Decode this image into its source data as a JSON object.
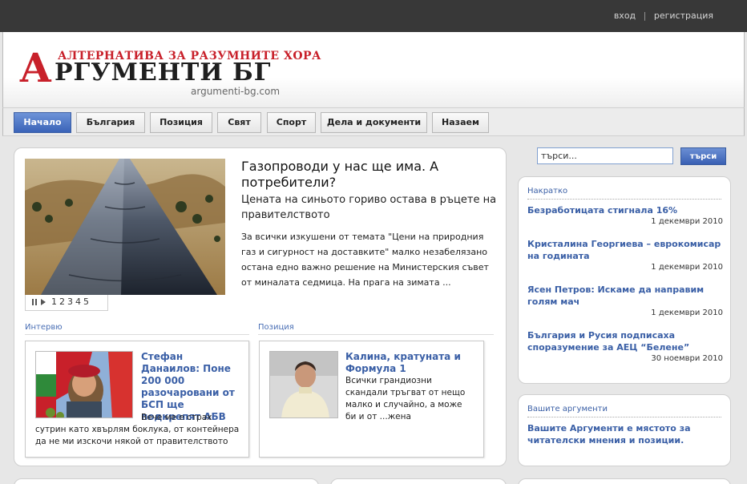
{
  "topbar": {
    "login": "вход",
    "separator": "|",
    "register": "регистрация"
  },
  "header": {
    "logo_initial": "А",
    "logo_rest": "РГУМЕНТИ БГ",
    "tagline": "АЛТЕРНАТИВА ЗА РАЗУМНИТЕ ХОРА",
    "domain": "argumenti-bg.com"
  },
  "nav": {
    "items": [
      {
        "label": "Начало",
        "active": true
      },
      {
        "label": "България"
      },
      {
        "label": "Позиция"
      },
      {
        "label": "Свят"
      },
      {
        "label": "Спорт"
      },
      {
        "label": "Дела и документи"
      },
      {
        "label": "Назаем"
      }
    ]
  },
  "search": {
    "placeholder": "търси...",
    "button": "търси"
  },
  "feature": {
    "title": "Газопроводи у нас ще има. А потребители?",
    "subtitle": "Цената на синьото гориво остава в ръцете на правителството",
    "text": "За всички изкушени от темата \"Цени на природния газ и сигурност на доставките\" малко незабелязано остана едно важно решение на Министерския съвет от миналата седмица. На прага на зимата ...",
    "slides": [
      "1",
      "2",
      "3",
      "4",
      "5"
    ]
  },
  "sections": {
    "left_label": "Интервю",
    "right_label": "Позиция"
  },
  "interview": {
    "title": "Стефан Данаилов: Поне 200 000 разочаровани от БСП ще подкрепят АБВ",
    "text": "Вече ме е страх сутрин като хвърлям боклука, от контейнера да не ми изскочи някой от правителството"
  },
  "position": {
    "title": "Калина, кратуната и Формула 1",
    "text": "Всички грандиозни скандали тръгват от нещо малко и случайно, а може би и от ...жена"
  },
  "brief": {
    "heading": "Накратко",
    "items": [
      {
        "title": "Безработицата стигнала 16%",
        "date": "1 декември 2010"
      },
      {
        "title": "Кристалина Георгиева – еврокомисар на годината",
        "date": "1 декември 2010"
      },
      {
        "title": "Ясен Петров: Искаме да направим голям мач",
        "date": "1 декември 2010"
      },
      {
        "title": "България и Русия подписаха споразумение за АЕЦ “Белене”",
        "date": "30 ноември 2010"
      }
    ]
  },
  "your_args": {
    "heading": "Вашите аргументи",
    "text": "Вашите Аргументи е мястото за читателски мнения и позиции."
  },
  "colors": {
    "accent": "#3a5fa6",
    "brand_red": "#c8202a",
    "topbar": "#383838"
  }
}
